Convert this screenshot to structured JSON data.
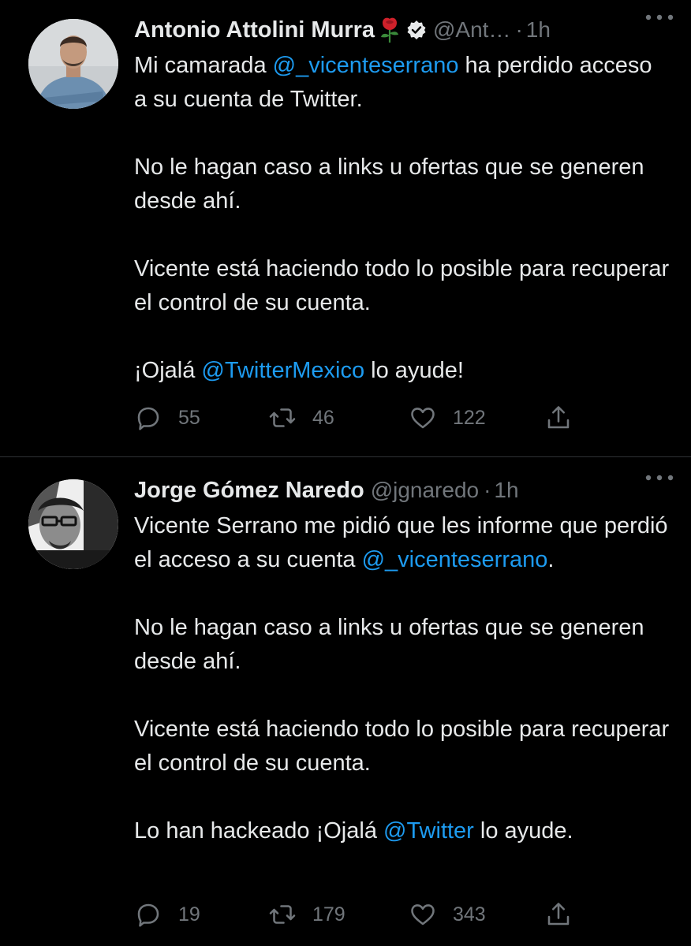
{
  "tweets": [
    {
      "author": {
        "name": "Antonio Attolini Murra",
        "emoji": "🌹",
        "verified": true,
        "handle": "@Ant…",
        "time": "1h"
      },
      "paragraphs": [
        {
          "pre": "Mi camarada ",
          "mention": "@_vicenteserrano",
          "post": " ha perdido acceso a su cuenta de Twitter."
        },
        {
          "text": "No le hagan caso a links u ofertas que se generen desde ahí."
        },
        {
          "text": "Vicente está haciendo todo lo posible para recuperar el control de su cuenta."
        },
        {
          "pre": "¡Ojalá ",
          "mention": "@TwitterMexico",
          "post": " lo ayude!"
        }
      ],
      "stats": {
        "replies": "55",
        "retweets": "46",
        "likes": "122"
      }
    },
    {
      "author": {
        "name": "Jorge Gómez Naredo",
        "handle": "@jgnaredo",
        "time": "1h"
      },
      "paragraphs": [
        {
          "pre": "Vicente Serrano me pidió que les informe que perdió el acceso a su cuenta ",
          "mention": "@_vicenteserrano",
          "post": "."
        },
        {
          "text": "No le hagan caso a links u ofertas que se generen desde ahí."
        },
        {
          "text": "Vicente está haciendo todo lo posible para recuperar el control de su cuenta."
        },
        {
          "pre": "Lo han hackeado ¡Ojalá ",
          "mention": "@Twitter",
          "post": " lo ayude."
        }
      ],
      "stats": {
        "replies": "19",
        "retweets": "179",
        "likes": "343"
      }
    }
  ],
  "separators": {
    "dot": "·"
  },
  "colors": {
    "background": "#000000",
    "text": "#e7e9ea",
    "muted": "#71767b",
    "accent": "#1d9bf0",
    "verified": "#e7e9ea",
    "divider": "#2f3336"
  },
  "icons": [
    "more-icon",
    "reply-icon",
    "retweet-icon",
    "like-icon",
    "share-icon",
    "verified-badge-icon",
    "rose-emoji"
  ]
}
